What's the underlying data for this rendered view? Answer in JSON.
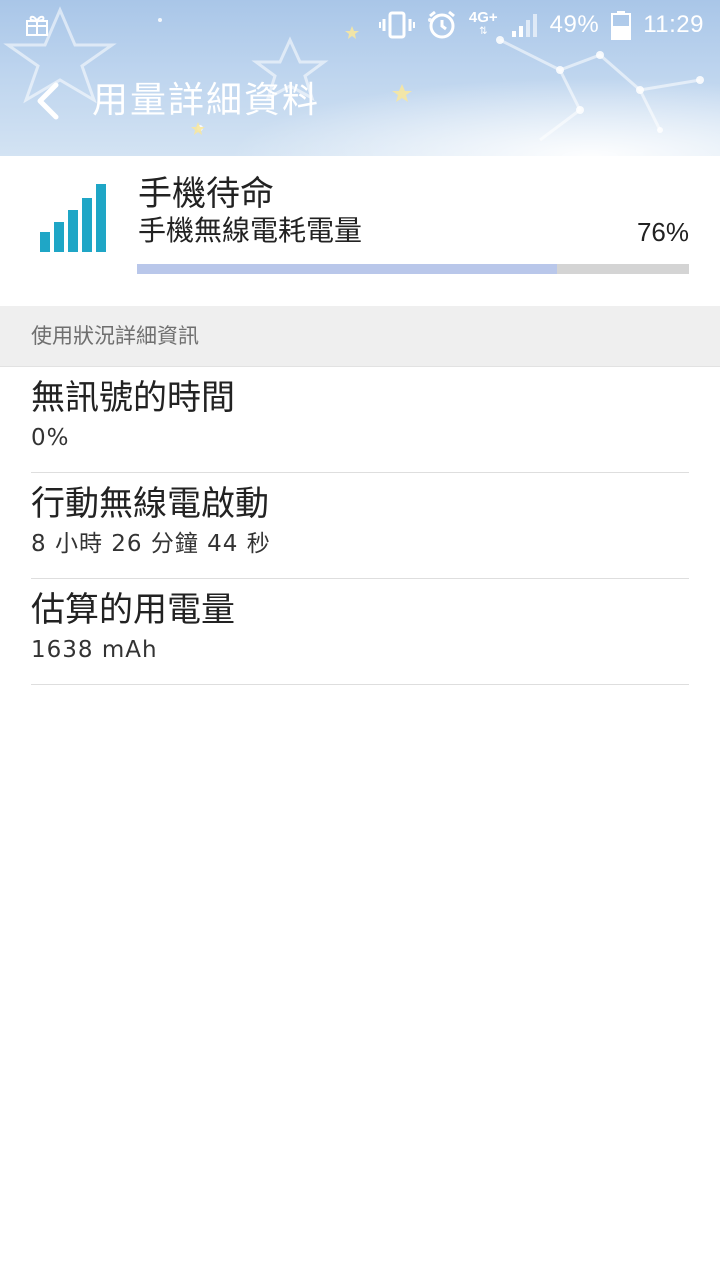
{
  "status_bar": {
    "battery_percent": "49%",
    "time": "11:29",
    "network_label": "4G+",
    "icons": [
      "gift-icon",
      "vibrate-icon",
      "alarm-icon",
      "network-4g-icon",
      "signal-icon",
      "battery-icon"
    ]
  },
  "toolbar": {
    "title": "用量詳細資料",
    "back_icon": "chevron-left-icon"
  },
  "summary": {
    "icon": "signal-strength-icon",
    "title": "手機待命",
    "subtitle": "手機無線電耗電量",
    "percent_text": "76%",
    "progress_fraction": 0.76
  },
  "section": {
    "header": "使用狀況詳細資訊"
  },
  "details": [
    {
      "label": "無訊號的時間",
      "value": "0%"
    },
    {
      "label": "行動無線電啟動",
      "value": "8 小時 26 分鐘 44 秒"
    },
    {
      "label": "估算的用電量",
      "value": "1638 mAh"
    }
  ],
  "colors": {
    "accent_teal": "#1fa6c6",
    "progress_fill": "#b9c7ea",
    "progress_track": "#d4d4d4",
    "section_bg": "#efefef"
  }
}
